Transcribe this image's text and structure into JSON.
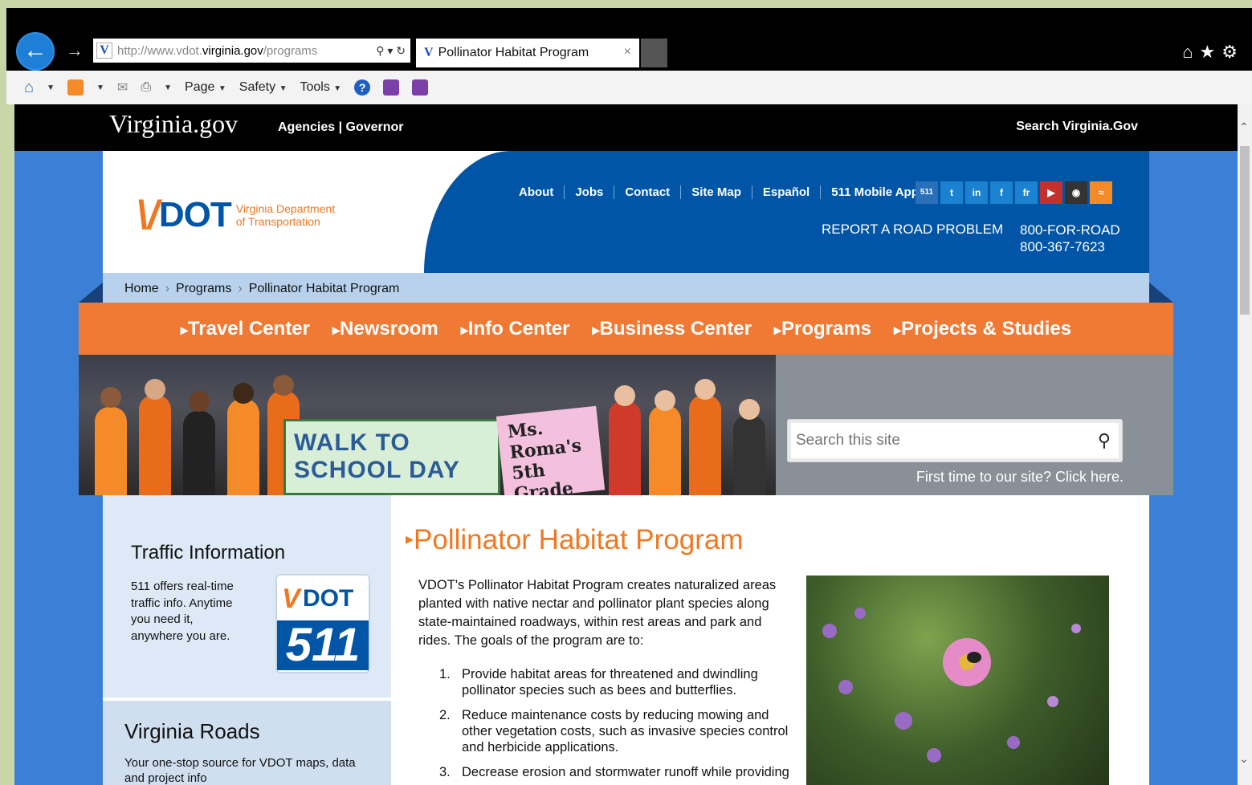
{
  "browser": {
    "address_prefix": "http://www.vdot.",
    "address_domain": "virginia.gov",
    "address_suffix": "/programs",
    "tab_title": "Pollinator Habitat Program",
    "tab_close": "×",
    "command_bar": {
      "page": "Page",
      "safety": "Safety",
      "tools": "Tools"
    }
  },
  "gov": {
    "logo": "Virginia.gov",
    "links": "Agencies | Governor",
    "search": "Search Virginia.Gov"
  },
  "header": {
    "logo_sub_line1": "Virginia Department",
    "logo_sub_line2": "of Transportation",
    "top_links": [
      "About",
      "Jobs",
      "Contact",
      "Site Map",
      "Español",
      "511 Mobile App"
    ],
    "social_icons": [
      "511",
      "twitter-icon",
      "linkedin-icon",
      "facebook-icon",
      "flickr-icon",
      "youtube-icon",
      "instagram-icon",
      "rss-icon"
    ],
    "report": "REPORT A ROAD PROBLEM",
    "phone1": "800-FOR-ROAD",
    "phone2": "800-367-7623"
  },
  "breadcrumb": [
    "Home",
    "Programs",
    "Pollinator Habitat Program"
  ],
  "nav": [
    "Travel Center",
    "Newsroom",
    "Info Center",
    "Business Center",
    "Programs",
    "Projects & Studies"
  ],
  "banner": {
    "sign1": "WALK TO SCHOOL DAY",
    "sign2": "Ms. Roma's 5th Grade",
    "search_placeholder": "Search this site",
    "first_time": "First time to our site? Click here."
  },
  "sidebar": {
    "traffic_title": "Traffic Information",
    "traffic_text": "511 offers real-time traffic info. Anytime you need it, anywhere you are.",
    "badge_number": "511",
    "roads_title": "Virginia Roads",
    "roads_text": "Your one-stop source for VDOT maps, data and project info"
  },
  "main": {
    "title": "Pollinator Habitat Program",
    "intro": "VDOT's Pollinator Habitat Program creates naturalized areas planted with native nectar and pollinator plant species along state-maintained roadways, within rest areas and park and rides. The goals of the program are to:",
    "goals": [
      {
        "num": "1.",
        "text": "Provide habitat areas for threatened and dwindling pollinator species such as bees and butterflies."
      },
      {
        "num": "2.",
        "text": "Reduce maintenance costs by reducing mowing and other vegetation costs, such as invasive species control and herbicide applications."
      },
      {
        "num": "3.",
        "text": "Decrease erosion and stormwater runoff while providing"
      }
    ]
  }
}
